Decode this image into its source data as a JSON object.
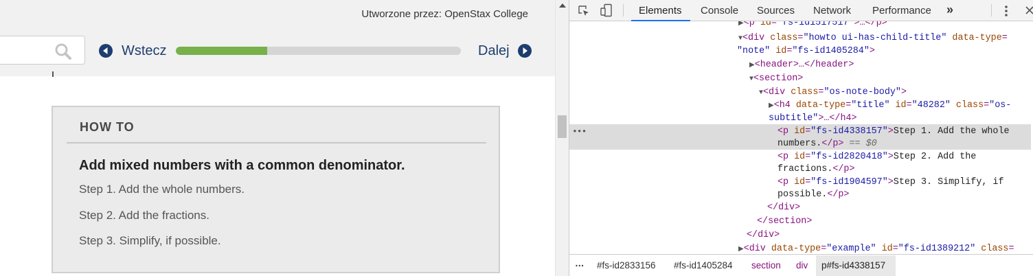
{
  "page": {
    "author_line": "Utworzone przez: OpenStax College",
    "prev_label": "Wstecz",
    "next_label": "Dalej",
    "progress_fraction": 0.32,
    "howto": {
      "header": "HOW TO",
      "title": "Add mixed numbers with a common denominator.",
      "steps": [
        "Step 1. Add the whole numbers.",
        "Step 2. Add the fractions.",
        "Step 3. Simplify, if possible."
      ]
    }
  },
  "devtools": {
    "tabs": [
      "Elements",
      "Console",
      "Sources",
      "Network",
      "Performance"
    ],
    "active_tab": "Elements",
    "more_tabs": "»",
    "selected_marker": "== $0",
    "dom_lines": [
      {
        "tag_open": "<p ",
        "attr": "id",
        "eq": "=",
        "val": "\"fs-id1517517\"",
        "rest": ">…</p>"
      },
      {
        "tag_open": "<div ",
        "attr": "class",
        "eq": "=",
        "val": "\"howto ui-has-child-title\"",
        "attr2": " data-type",
        "eq2": "="
      },
      {
        "val": "\"note\"",
        "attr": " id",
        "eq": "=",
        "val2": "\"fs-id1405284\"",
        "rest": ">"
      },
      {
        "tag_open": "<header>",
        "rest": "…</header>"
      },
      {
        "tag_open": "<section>"
      },
      {
        "tag_open": "<div ",
        "attr": "class",
        "eq": "=",
        "val": "\"os-note-body\"",
        "rest": ">"
      },
      {
        "tag_open": "<h4 ",
        "attr": "data-type",
        "eq": "=",
        "val": "\"title\"",
        "attr2": " id",
        "eq2": "=",
        "val2": "\"48282\"",
        "attr3": " class",
        "eq3": "=",
        "val3": "\"os-"
      },
      {
        "val": "subtitle\"",
        "rest": ">…</h4>"
      },
      {
        "tag_open": "<p ",
        "attr": "id",
        "eq": "=",
        "val": "\"fs-id4338157\"",
        "rest": ">",
        "text": "Step 1. Add the whole"
      },
      {
        "text": "numbers.",
        "rest": "</p>"
      },
      {
        "tag_open": "<p ",
        "attr": "id",
        "eq": "=",
        "val": "\"fs-id2820418\"",
        "rest": ">",
        "text": "Step 2. Add the"
      },
      {
        "text": "fractions.",
        "rest": "</p>"
      },
      {
        "tag_open": "<p ",
        "attr": "id",
        "eq": "=",
        "val": "\"fs-id1904597\"",
        "rest": ">",
        "text": "Step 3. Simplify, if"
      },
      {
        "text": "possible.",
        "rest": "</p>"
      },
      {
        "tag_open": "</div>"
      },
      {
        "tag_open": "</section>"
      },
      {
        "tag_open": "</div>"
      },
      {
        "tag_open": "<div ",
        "attr": "data-type",
        "eq": "=",
        "val": "\"example\"",
        "attr2": " id",
        "eq2": "=",
        "val2": "\"fs-id1389212\"",
        "attr3": " class",
        "eq3": "="
      }
    ],
    "breadcrumbs": [
      "…",
      "#fs-id2833156",
      "#fs-id1405284",
      "section",
      "div",
      "p#fs-id4338157"
    ]
  },
  "colors": {
    "accent": "#1d3d6e",
    "progress": "#78b04a",
    "devtools_active": "#1a73e8"
  }
}
